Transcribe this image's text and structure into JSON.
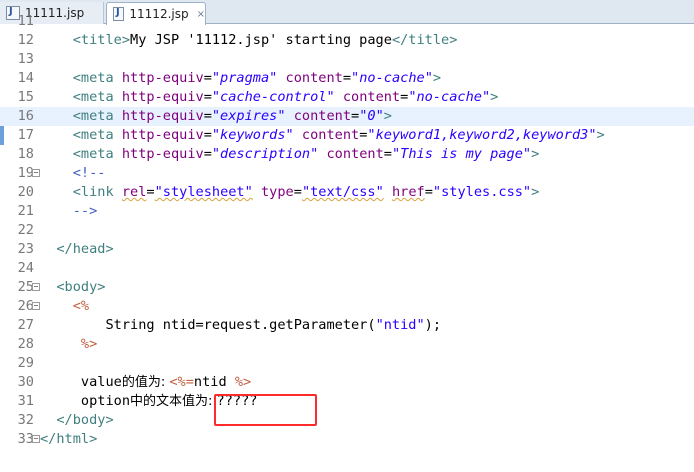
{
  "tabs": [
    {
      "label": "11111.jsp",
      "active": false
    },
    {
      "label": "11112.jsp",
      "active": true,
      "close_icon": "×"
    }
  ],
  "editor": {
    "lines": [
      {
        "n": "11",
        "tokens": []
      },
      {
        "n": "12",
        "tokens": [
          [
            "tag",
            "    <title>"
          ],
          [
            "text",
            "My JSP '11112.jsp' starting page"
          ],
          [
            "tag",
            "</title>"
          ]
        ]
      },
      {
        "n": "13",
        "tokens": []
      },
      {
        "n": "14",
        "tokens": [
          [
            "tag",
            "    <meta "
          ],
          [
            "attr",
            "http-equiv"
          ],
          [
            "text",
            "="
          ],
          [
            "val",
            "\"pragma\""
          ],
          [
            "text",
            " "
          ],
          [
            "attr",
            "content"
          ],
          [
            "text",
            "="
          ],
          [
            "val",
            "\"no-cache\""
          ],
          [
            "tag",
            ">"
          ]
        ]
      },
      {
        "n": "15",
        "tokens": [
          [
            "tag",
            "    <meta "
          ],
          [
            "attr",
            "http-equiv"
          ],
          [
            "text",
            "="
          ],
          [
            "val",
            "\"cache-control\""
          ],
          [
            "text",
            " "
          ],
          [
            "attr",
            "content"
          ],
          [
            "text",
            "="
          ],
          [
            "val",
            "\"no-cache\""
          ],
          [
            "tag",
            ">"
          ]
        ]
      },
      {
        "n": "16",
        "highlight": true,
        "tokens": [
          [
            "tag",
            "    <meta "
          ],
          [
            "attr",
            "http-equiv"
          ],
          [
            "text",
            "="
          ],
          [
            "val",
            "\"expires\""
          ],
          [
            "text",
            " "
          ],
          [
            "attr",
            "content"
          ],
          [
            "text",
            "="
          ],
          [
            "val",
            "\"0\""
          ],
          [
            "tag",
            ">"
          ]
        ]
      },
      {
        "n": "17",
        "tokens": [
          [
            "tag",
            "    <meta "
          ],
          [
            "attr",
            "http-equiv"
          ],
          [
            "text",
            "="
          ],
          [
            "val",
            "\"keywords\""
          ],
          [
            "text",
            " "
          ],
          [
            "attr",
            "content"
          ],
          [
            "text",
            "="
          ],
          [
            "val",
            "\"keyword1,keyword2,keyword3\""
          ],
          [
            "tag",
            ">"
          ]
        ]
      },
      {
        "n": "18",
        "tokens": [
          [
            "tag",
            "    <meta "
          ],
          [
            "attr",
            "http-equiv"
          ],
          [
            "text",
            "="
          ],
          [
            "val",
            "\"description\""
          ],
          [
            "text",
            " "
          ],
          [
            "attr",
            "content"
          ],
          [
            "text",
            "="
          ],
          [
            "val",
            "\"This is my page\""
          ],
          [
            "tag",
            ">"
          ]
        ]
      },
      {
        "n": "19",
        "fold": "−",
        "tokens": [
          [
            "cmt",
            "    <!--"
          ]
        ]
      },
      {
        "n": "20",
        "tokens": [
          [
            "tag",
            "    <link "
          ],
          [
            "attr-u",
            "rel"
          ],
          [
            "text",
            "="
          ],
          [
            "str-u",
            "\"stylesheet\""
          ],
          [
            "text",
            " "
          ],
          [
            "attr",
            "type"
          ],
          [
            "text",
            "="
          ],
          [
            "str-u",
            "\"text/css\""
          ],
          [
            "text",
            " "
          ],
          [
            "attr-u",
            "href"
          ],
          [
            "text",
            "="
          ],
          [
            "str",
            "\"styles.css\""
          ],
          [
            "tag",
            ">"
          ]
        ]
      },
      {
        "n": "21",
        "tokens": [
          [
            "cmt",
            "    -->"
          ]
        ]
      },
      {
        "n": "22",
        "tokens": []
      },
      {
        "n": "23",
        "tokens": [
          [
            "tag",
            "  </head>"
          ]
        ]
      },
      {
        "n": "24",
        "tokens": []
      },
      {
        "n": "25",
        "fold": "−",
        "tokens": [
          [
            "tag",
            "  <body>"
          ]
        ]
      },
      {
        "n": "26",
        "fold": "−",
        "tokens": [
          [
            "jsp",
            "    <%"
          ]
        ]
      },
      {
        "n": "27",
        "tokens": [
          [
            "java",
            "        String ntid=request.getParameter("
          ],
          [
            "str",
            "\"ntid\""
          ],
          [
            "java",
            ");"
          ]
        ]
      },
      {
        "n": "28",
        "tokens": [
          [
            "jsp",
            "     %>"
          ]
        ]
      },
      {
        "n": "29",
        "tokens": []
      },
      {
        "n": "30",
        "tokens": [
          [
            "text",
            "     value"
          ],
          [
            "cjk",
            "的值为: "
          ],
          [
            "jsp",
            "<%="
          ],
          [
            "java",
            "ntid "
          ],
          [
            "jsp",
            "%>"
          ]
        ]
      },
      {
        "n": "31",
        "tokens": [
          [
            "text",
            "     option"
          ],
          [
            "cjk",
            "中的文本值为: "
          ],
          [
            "text",
            "?????"
          ]
        ]
      },
      {
        "n": "32",
        "tokens": [
          [
            "tag",
            "  </body>"
          ]
        ]
      },
      {
        "n": "33",
        "fold": "−",
        "tokens": [
          [
            "tag",
            "</html>"
          ]
        ]
      }
    ]
  }
}
